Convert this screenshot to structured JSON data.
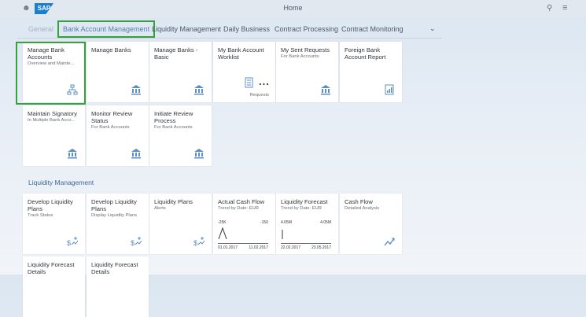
{
  "shell": {
    "title": "Home",
    "logo": "SAP",
    "user_icon": "person-icon",
    "search_icon": "search-icon",
    "menu_icon": "menu-icon"
  },
  "tabs": [
    {
      "label": "General"
    },
    {
      "label": "Bank Account Management"
    },
    {
      "label": "Liquidity Management"
    },
    {
      "label": "Daily Business"
    },
    {
      "label": "Contract Processing"
    },
    {
      "label": "Contract Monitoring"
    }
  ],
  "tiles_row1": [
    {
      "title": "Manage Bank Accounts",
      "subtitle": "Overview and Mainte...",
      "icon": "org-chart-icon"
    },
    {
      "title": "Manage Banks",
      "subtitle": "",
      "icon": "bank-icon"
    },
    {
      "title": "Manage Banks - Basic",
      "subtitle": "",
      "icon": "bank-icon"
    },
    {
      "title": "My Bank Account Worklist",
      "subtitle": "",
      "number": "...",
      "footer": "Requests",
      "icon": "document-icon"
    },
    {
      "title": "My Sent Requests",
      "subtitle": "For Bank Accounts",
      "icon": "bank-icon"
    },
    {
      "title": "Foreign Bank Account Report",
      "subtitle": "",
      "icon": "report-icon"
    }
  ],
  "tiles_row2": [
    {
      "title": "Maintain Signatory",
      "subtitle": "In Multiple Bank Acco...",
      "icon": "bank-icon"
    },
    {
      "title": "Monitor Review Status",
      "subtitle": "For Bank Accounts",
      "icon": "bank-icon"
    },
    {
      "title": "Initiate Review Process",
      "subtitle": "For Bank Accounts",
      "icon": "bank-icon"
    }
  ],
  "section_liquidity": "Liquidity Management",
  "tiles_row3": [
    {
      "title": "Develop Liquidity Plans",
      "subtitle": "Track Status",
      "icon": "money-plan-icon"
    },
    {
      "title": "Develop Liquidity Plans",
      "subtitle": "Display Liquidity Plans",
      "icon": "money-plan-icon"
    },
    {
      "title": "Liquidity Plans",
      "subtitle": "Alerts",
      "icon": "money-plan-icon"
    },
    {
      "title": "Actual Cash Flow",
      "subtitle": "Trend by Date: EUR",
      "chart": {
        "left": "-25K",
        "right": "-150",
        "start": "01.01.2017",
        "end": "11.02.2017"
      }
    },
    {
      "title": "Liquidity Forecast",
      "subtitle": "Trend by Date: EUR",
      "chart": {
        "left": "4.05M",
        "right": "4.05M",
        "start": "22.02.2017",
        "end": "23.05.2017"
      }
    },
    {
      "title": "Cash Flow",
      "subtitle": "Detailed Analysis",
      "icon": "flow-icon"
    }
  ],
  "tiles_row4": [
    {
      "title": "Liquidity Forecast Details"
    },
    {
      "title": "Liquidity Forecast Details"
    }
  ],
  "colors": {
    "accent": "#3f6897",
    "highlight_box": "#35a13d",
    "icon": "#5b8dc9"
  }
}
